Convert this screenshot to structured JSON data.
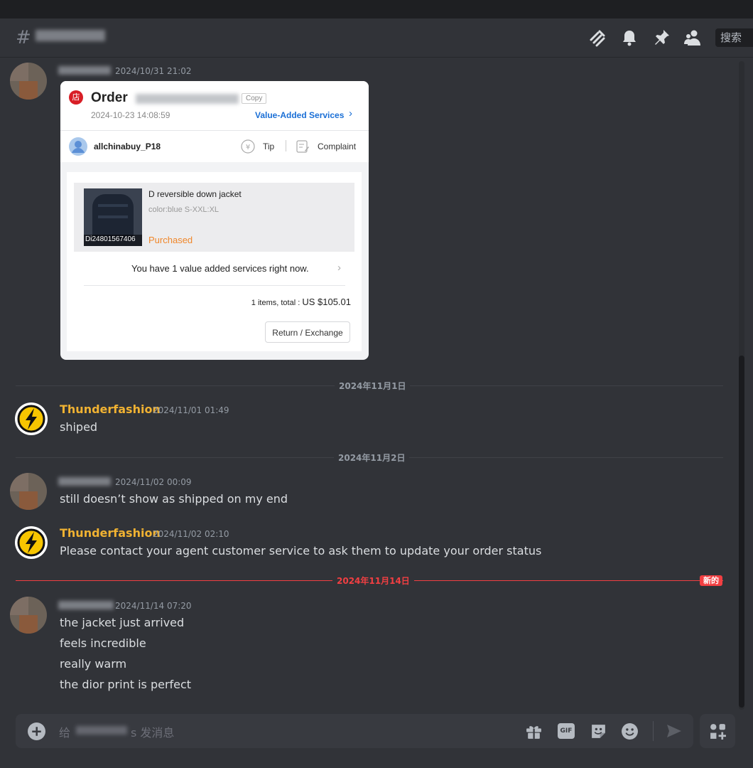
{
  "header": {
    "hash_symbol": "#",
    "search_placeholder": "搜索",
    "icons": [
      "threads-icon",
      "bell-icon",
      "pin-icon",
      "members-icon"
    ]
  },
  "messages": [
    {
      "timestamp": "2024/10/31 21:02",
      "order_card": {
        "store_badge": "店",
        "title": "Order",
        "copy_label": "Copy",
        "date": "2024-10-23 14:08:59",
        "value_added_link": "Value-Added Services",
        "seller": "allchinabuy_P18",
        "tip_label": "Tip",
        "complaint_label": "Complaint",
        "item_name": "D reversible down jacket",
        "item_variant": "color:blue S-XXL:XL",
        "item_code": "Di24801567406",
        "item_status": "Purchased",
        "value_added_notice": "You have 1 value added services right now.",
        "total_prefix": "1 items, total : ",
        "total_amount": "US $105.01",
        "return_button": "Return / Exchange"
      }
    },
    {
      "date_divider": "2024年11月1日",
      "username": "Thunderfashion",
      "timestamp": "2024/11/01 01:49",
      "text": "shiped"
    },
    {
      "date_divider": "2024年11月2日",
      "timestamp": "2024/11/02 00:09",
      "text": "still doesn’t show as shipped on my end"
    },
    {
      "username": "Thunderfashion",
      "timestamp": "2024/11/02 02:10",
      "text": "Please contact your agent customer service to ask them to update your order status"
    },
    {
      "date_divider": "2024年11月14日",
      "new_badge": "新的",
      "timestamp": "2024/11/14 07:20",
      "lines": [
        "the jacket just arrived",
        "feels incredible",
        "really warm",
        "the dior print is perfect"
      ]
    }
  ],
  "composer": {
    "placeholder_prefix": "给",
    "placeholder_suffix": "s 发消息",
    "gif_label": "GIF"
  },
  "colors": {
    "accent_username": "#f0b232",
    "new_divider": "#f23f42",
    "link_blue": "#1a6fd6",
    "purchased_orange": "#f0872a"
  }
}
